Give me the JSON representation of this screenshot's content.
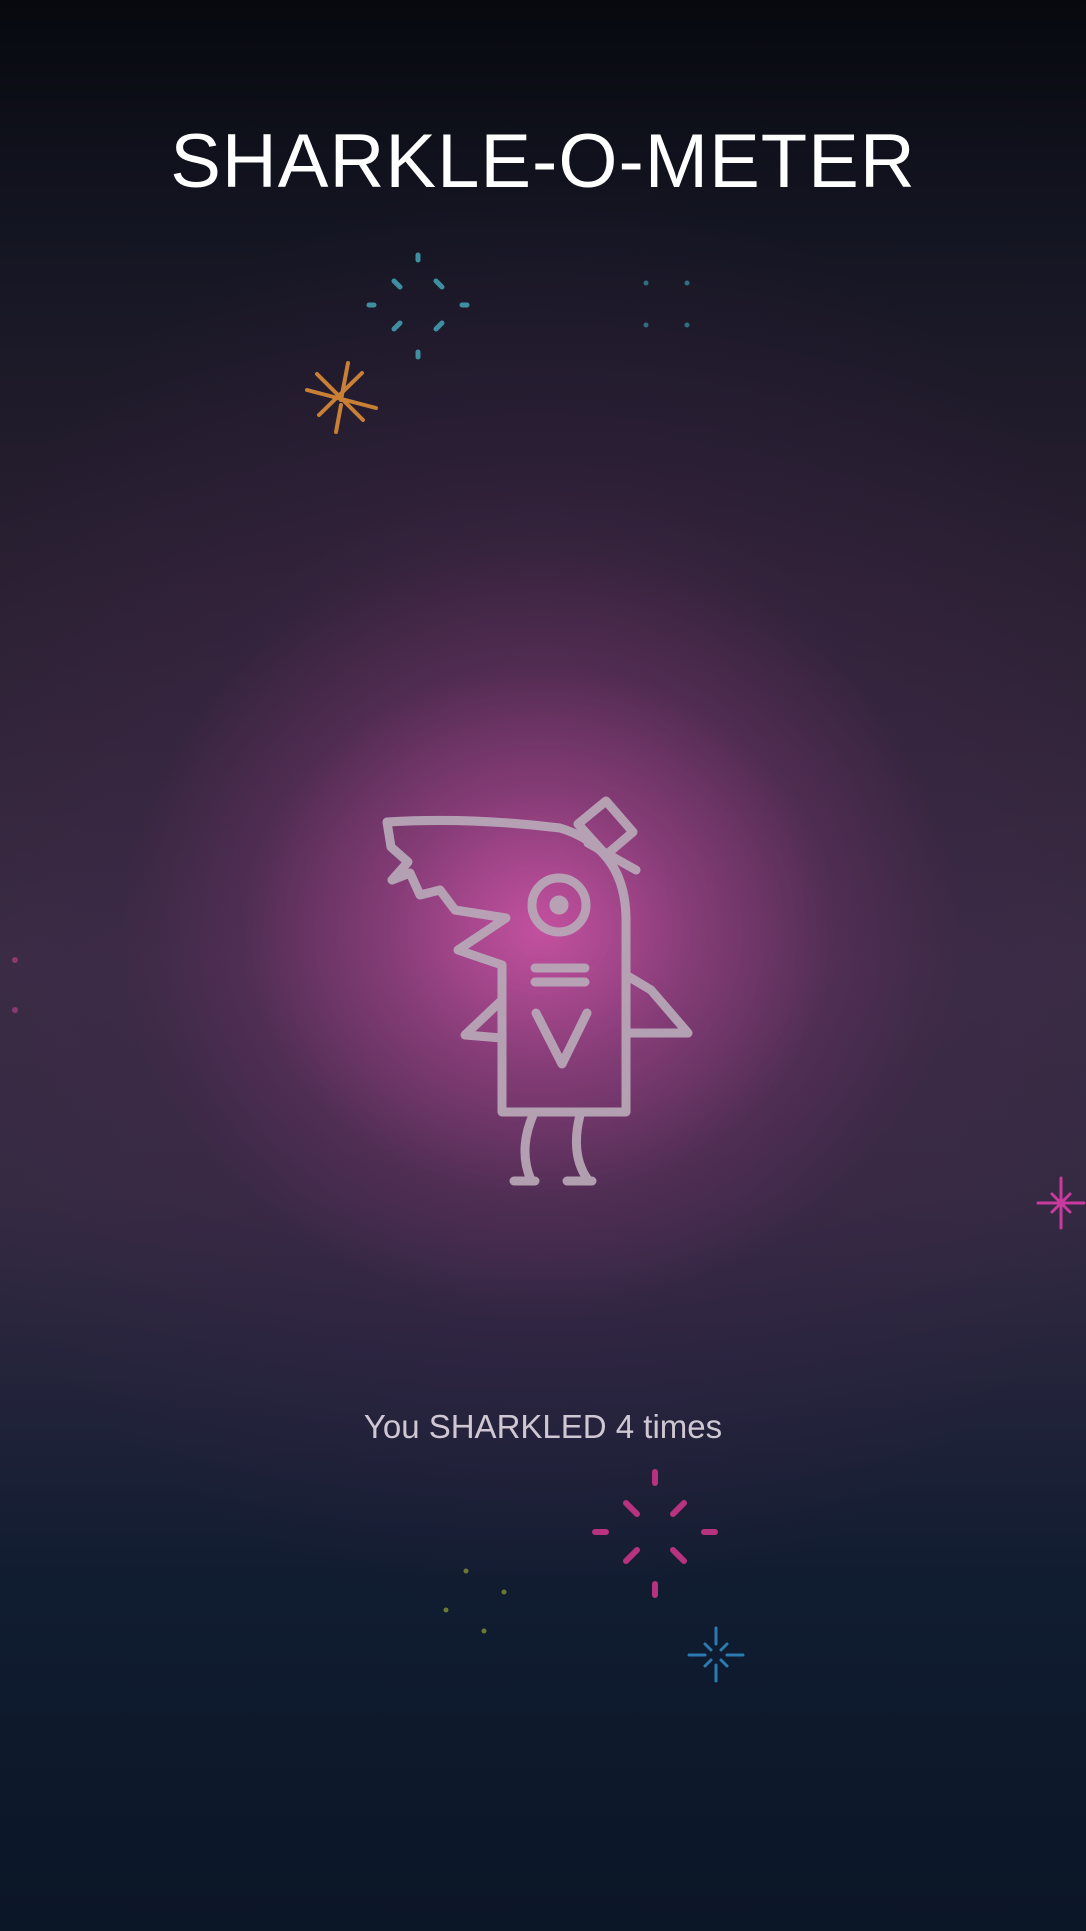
{
  "title": "SHARKLE-O-METER",
  "counter_text": "You SHARKLED 4 times",
  "colors": {
    "title_text": "#ffffff",
    "counter_text": "#cfc8d3",
    "glow": "#d656ac",
    "mascot_stroke": "#b9a9b8",
    "sparkle_teal": "#3f8fa0",
    "sparkle_orange": "#d0823a",
    "sparkle_pink": "#c6388d",
    "sparkle_olive": "#7d8a3a",
    "sparkle_blue": "#2f7fb3",
    "sparkle_magenta": "#d13aa6"
  },
  "icons": {
    "mascot": "shark-with-top-hat-icon",
    "sparkles": [
      "sparkle-teal-icon",
      "sparkle-orange-icon",
      "sparkle-pink-icon",
      "sparkle-blue-icon",
      "sparkle-magenta-icon"
    ]
  }
}
